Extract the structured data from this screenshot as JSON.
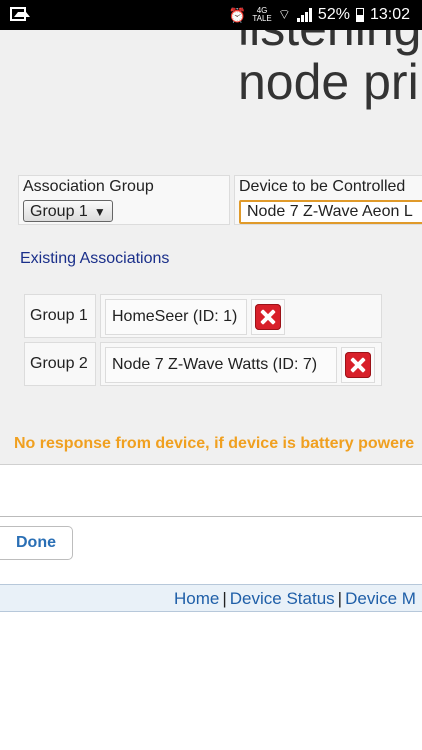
{
  "status_bar": {
    "network_label": "4G",
    "network_sub": "TALE",
    "battery_percent": "52%",
    "time": "13:02"
  },
  "page": {
    "heading_line1": "listening",
    "heading_line2": "node pri",
    "table": {
      "group_header": "Association Group",
      "group_selected": "Group 1",
      "device_header": "Device to be Controlled",
      "device_selected": "Node 7 Z-Wave Aeon L"
    },
    "existing_title": "Existing Associations",
    "associations": [
      {
        "group": "Group 1",
        "device": "HomeSeer (ID: 1)"
      },
      {
        "group": "Group 2",
        "device": "Node 7 Z-Wave Watts (ID: 7)"
      }
    ],
    "warning": "No response from device, if device is battery powere"
  },
  "done_label": "Done",
  "footer": {
    "links": [
      "Home",
      "Device Status",
      "Device M"
    ]
  },
  "colors": {
    "warning": "#f0a020",
    "link": "#1f5fa8",
    "delete": "#d8202a"
  }
}
